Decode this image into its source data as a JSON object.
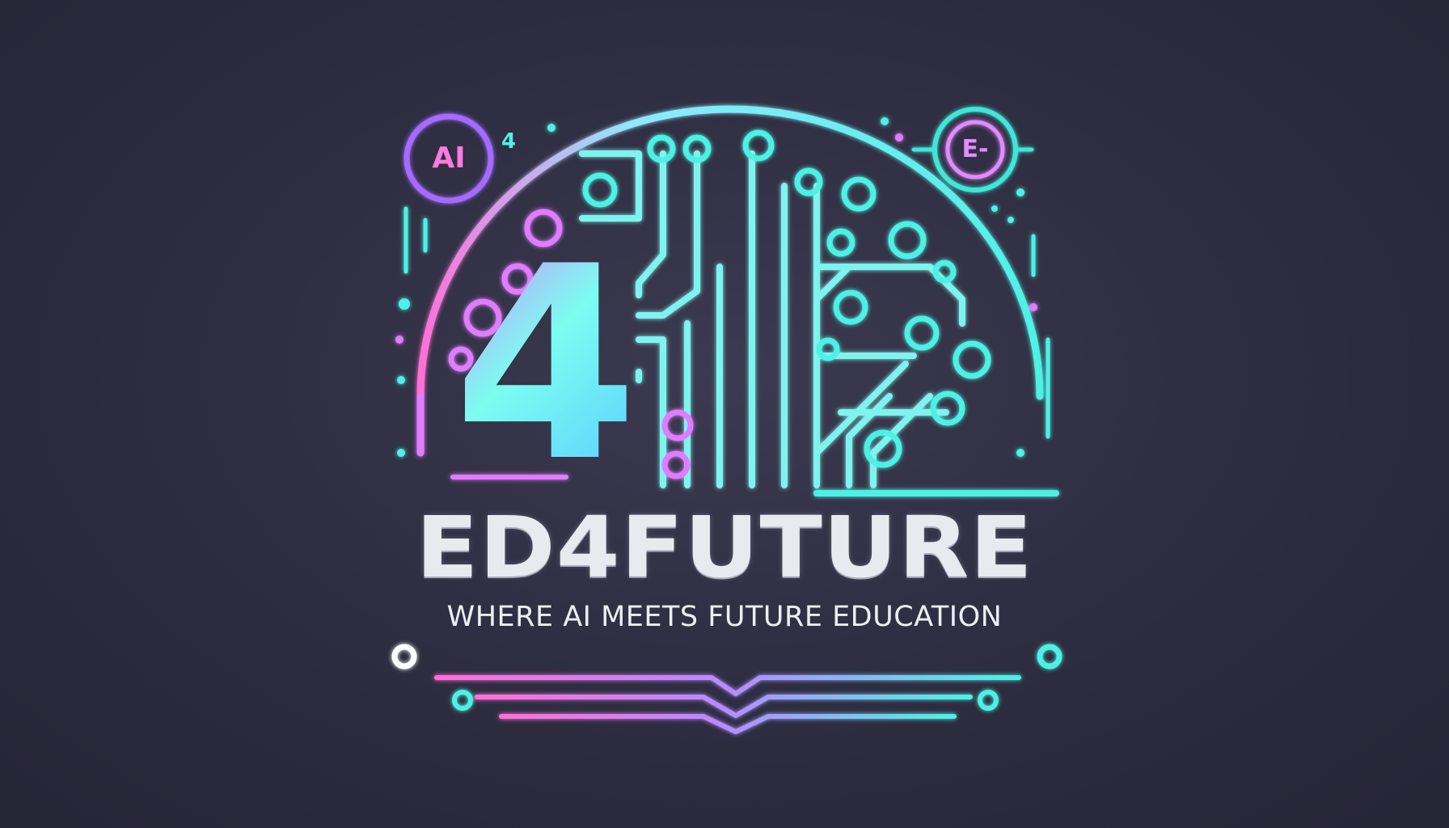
{
  "brand": {
    "title": "ED4FUTURE",
    "tagline": "WHERE AI MEETS FUTURE EDUCATION"
  },
  "emblem": {
    "big_numeral": "4",
    "ai_badge": "AI",
    "small_numeral": "4",
    "e_badge": "E-",
    "icon": "circuit-brain-icon"
  },
  "colors": {
    "background": "#2f2e42",
    "cyan": "#4ef1e3",
    "magenta": "#e07cff",
    "pink": "#ff6fd8",
    "text": "#e9eaf0"
  }
}
